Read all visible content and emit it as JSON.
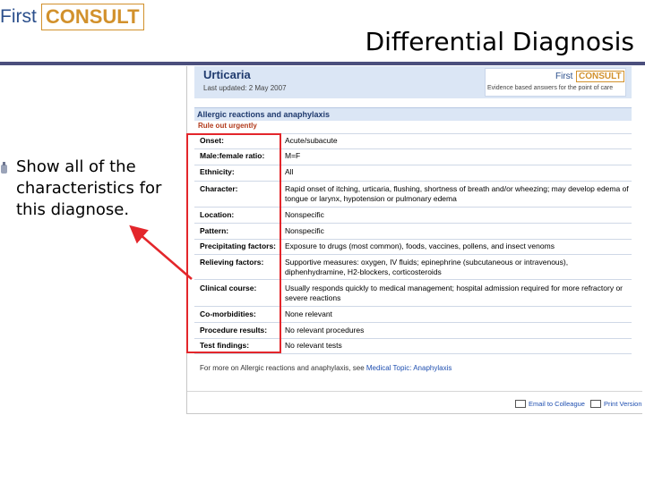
{
  "logo": {
    "first": "First",
    "consult": "CONSULT"
  },
  "slide": {
    "title": "Differential Diagnosis",
    "bullet": "Show all of the characteristics for this diagnose."
  },
  "screenshot": {
    "page_title": "Urticaria",
    "last_updated": "Last updated: 2 May 2007",
    "mini_logo": {
      "first": "First",
      "consult": "CONSULT",
      "tagline": "Evidence based answers for the point of care"
    },
    "section_heading": "Allergic reactions and anaphylaxis",
    "rule_out": "Rule out urgently",
    "rows": [
      {
        "label": "Onset:",
        "value": "Acute/subacute"
      },
      {
        "label": "Male:female ratio:",
        "value": "M=F"
      },
      {
        "label": "Ethnicity:",
        "value": "All"
      },
      {
        "label": "Character:",
        "value": "Rapid onset of itching, urticaria, flushing, shortness of breath and/or wheezing; may develop edema of tongue or larynx, hypotension or pulmonary edema"
      },
      {
        "label": "Location:",
        "value": "Nonspecific"
      },
      {
        "label": "Pattern:",
        "value": "Nonspecific"
      },
      {
        "label": "Precipitating factors:",
        "value": "Exposure to drugs (most common), foods, vaccines, pollens, and insect venoms"
      },
      {
        "label": "Relieving factors:",
        "value": "Supportive measures: oxygen, IV fluids; epinephrine (subcutaneous or intravenous), diphenhydramine, H2-blockers, corticosteroids"
      },
      {
        "label": "Clinical course:",
        "value": "Usually responds quickly to medical management; hospital admission required for more refractory or severe reactions"
      },
      {
        "label": "Co-morbidities:",
        "value": "None relevant"
      },
      {
        "label": "Procedure results:",
        "value": "No relevant procedures"
      },
      {
        "label": "Test findings:",
        "value": "No relevant tests"
      }
    ],
    "more_text": "For more on Allergic reactions and anaphylaxis, see",
    "more_link": "Medical Topic: Anaphylaxis",
    "footer": {
      "email": "Email to Colleague",
      "print": "Print Version"
    }
  },
  "colors": {
    "accent_red": "#e3262b",
    "brand_blue": "#2b4f8c",
    "brand_orange": "#d2912c",
    "title_rule": "#4b4f7d"
  }
}
